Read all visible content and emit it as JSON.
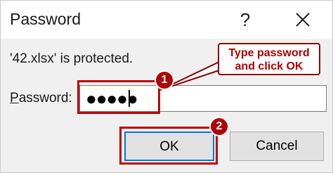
{
  "dialog": {
    "title": "Password",
    "help_label": "?",
    "message": "'42.xlsx' is protected.",
    "password_label_mnemonic": "P",
    "password_label_rest": "assword:",
    "password_value": "●●●●●",
    "ok_label": "OK",
    "cancel_label": "Cancel"
  },
  "annotations": {
    "step1": "1",
    "step2": "2",
    "callout_line1": "Type password",
    "callout_line2": "and click OK",
    "highlight_color": "#c00000",
    "badge_color": "#b10000"
  }
}
